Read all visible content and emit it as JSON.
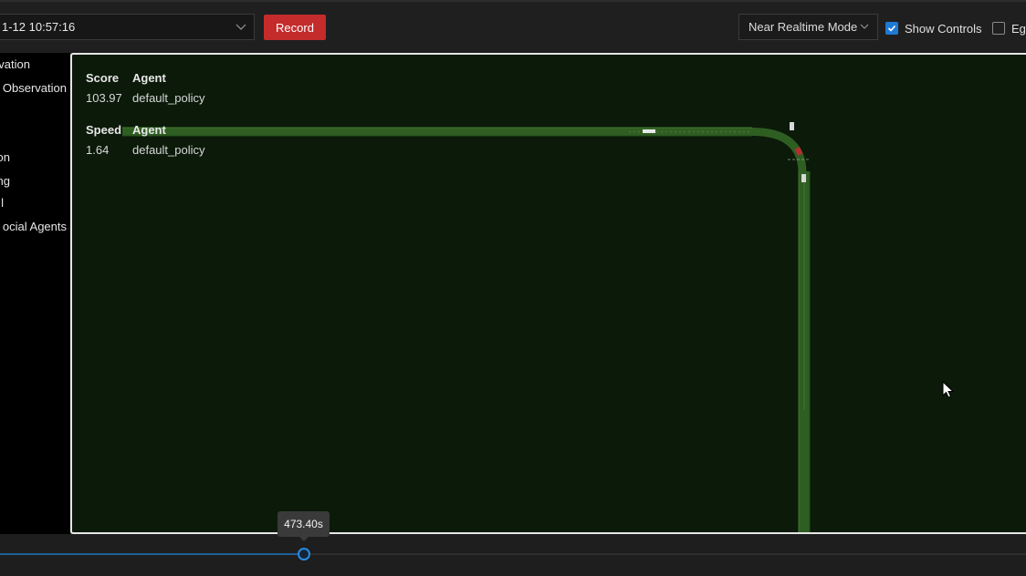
{
  "toolbar": {
    "session_value": "1-12 10:57:16",
    "record_label": "Record",
    "mode_value": "Near Realtime Mode",
    "show_controls_label": "Show Controls",
    "show_controls_checked": true,
    "ego_label": "Eg",
    "ego_checked": false
  },
  "sidebar": {
    "items": [
      {
        "label": "vation"
      },
      {
        "label": "t Observation"
      },
      {
        "label": "on"
      },
      {
        "label": "ng"
      },
      {
        "label": "l"
      },
      {
        "label": "ocial Agents"
      }
    ]
  },
  "hud": {
    "score": {
      "header": "Score",
      "agent_header": "Agent",
      "value": "103.97",
      "agent": "default_policy"
    },
    "speed": {
      "header": "Speed",
      "agent_header": "Agent",
      "value": "1.64",
      "agent": "default_policy"
    }
  },
  "timeline": {
    "tooltip": "473.40s",
    "progress_fraction": 0.296
  },
  "colors": {
    "road": "#2f5e22",
    "road_edge": "#3f7a2e",
    "map_bg": "#0b1a09",
    "record": "#c42b2b",
    "accent": "#1f7ad6",
    "ego_vehicle": "#b03030"
  },
  "icons": {
    "session_dropdown": "chevron-down-icon",
    "mode_dropdown": "chevron-down-icon",
    "checkbox": "checkmark-icon",
    "pointer": "mouse-cursor-icon"
  }
}
